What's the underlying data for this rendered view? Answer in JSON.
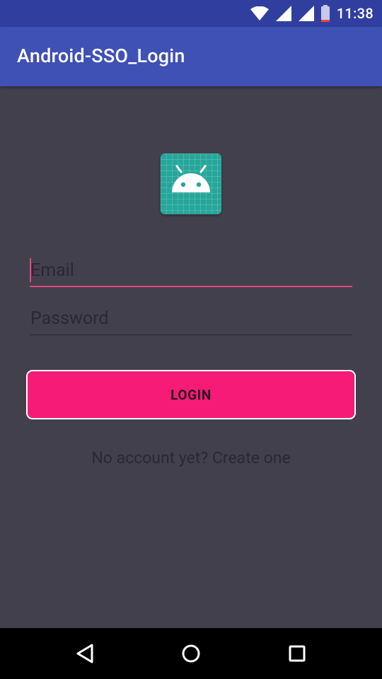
{
  "status_bar": {
    "time": "11:38",
    "icons": [
      "wifi-icon",
      "signal-icon",
      "signal-icon",
      "battery-icon"
    ]
  },
  "app_bar": {
    "title": "Android-SSO_Login"
  },
  "logo": {
    "icon": "android-robot-icon",
    "background_color": "#26a69a"
  },
  "form": {
    "email_placeholder": "Email",
    "email_value": "",
    "password_placeholder": "Password",
    "password_value": "",
    "login_label": "LOGIN",
    "signup_text": "No account yet? Create one"
  },
  "nav_bar": {
    "icons": [
      "back-icon",
      "home-icon",
      "recents-icon"
    ]
  },
  "colors": {
    "status_bar": "#303f9f",
    "app_bar": "#3f51b5",
    "background": "#43404d",
    "accent": "#f51b77",
    "field_accent": "#e8447a"
  }
}
